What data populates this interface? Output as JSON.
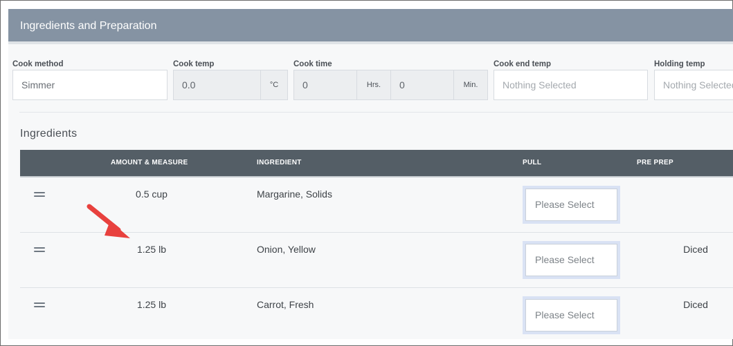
{
  "panel": {
    "title": "Ingredients and Preparation"
  },
  "fields": {
    "cook_method": {
      "label": "Cook method",
      "value": "Simmer"
    },
    "cook_temp": {
      "label": "Cook temp",
      "value": "0.0",
      "unit": "°C"
    },
    "cook_time": {
      "label": "Cook time",
      "hours_value": "0",
      "hours_unit": "Hrs.",
      "minutes_value": "0",
      "minutes_unit": "Min."
    },
    "cook_end_temp": {
      "label": "Cook end temp",
      "value": "Nothing Selected"
    },
    "holding_temp": {
      "label": "Holding temp",
      "value": "Nothing Selected"
    }
  },
  "ingredients": {
    "title": "Ingredients",
    "columns": {
      "amount": "AMOUNT & MEASURE",
      "ingredient": "INGREDIENT",
      "pull": "PULL",
      "pre_prep": "PRE PREP"
    },
    "rows": [
      {
        "amount": "0.5 cup",
        "ingredient": "Margarine, Solids",
        "pull": "Please Select",
        "pre_prep": ""
      },
      {
        "amount": "1.25 lb",
        "ingredient": "Onion, Yellow",
        "pull": "Please Select",
        "pre_prep": "Diced"
      },
      {
        "amount": "1.25 lb",
        "ingredient": "Carrot, Fresh",
        "pull": "Please Select",
        "pre_prep": "Diced"
      }
    ]
  },
  "annotation": {
    "icon": "red-arrow-icon",
    "color": "#e8413e"
  },
  "colors": {
    "header": "#8593a3",
    "table_header": "#545e66",
    "accent_select": "#d9e2f4"
  }
}
